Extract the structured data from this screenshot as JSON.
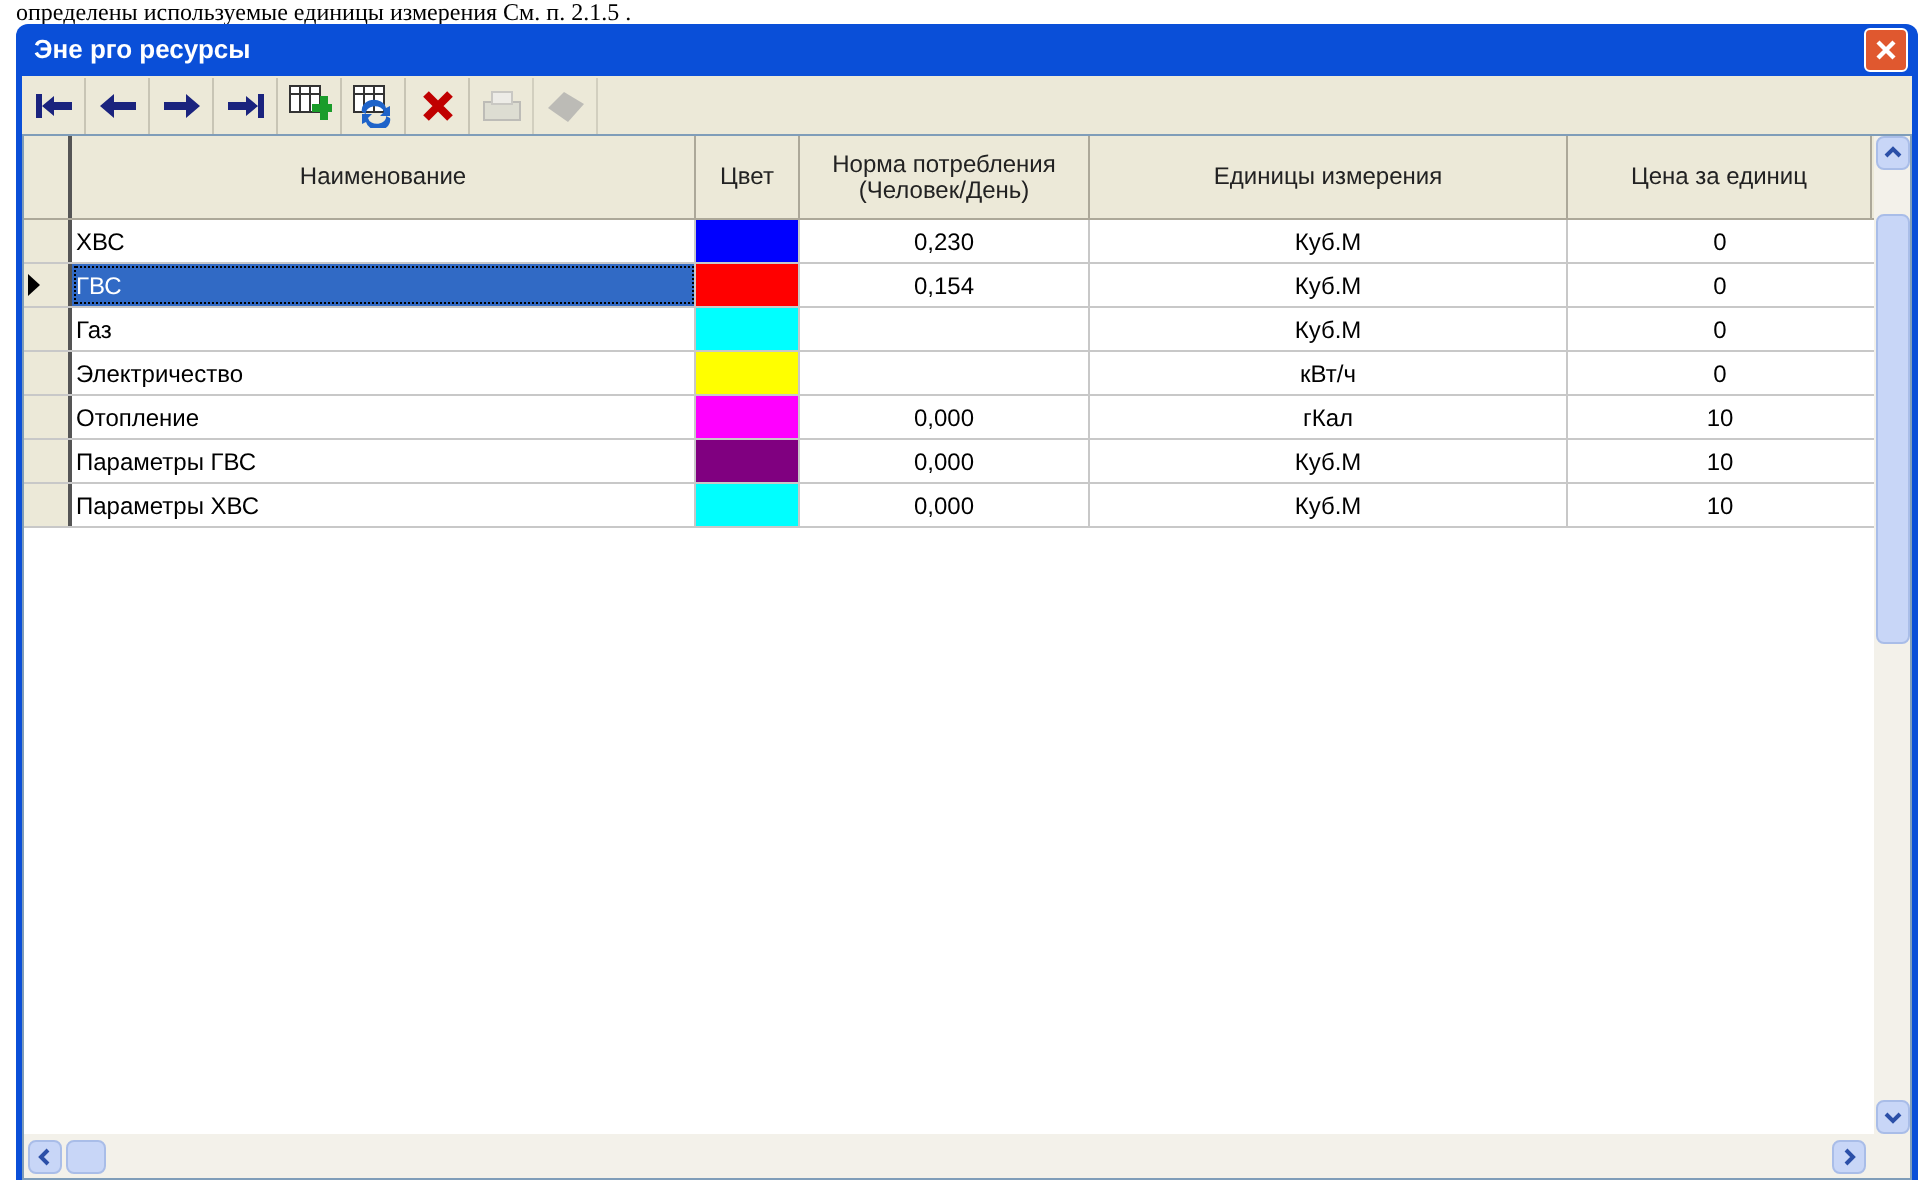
{
  "document_text": "определены используемые единицы измерения См. п. 2.1.5 .",
  "window": {
    "title": "Эне рго ресурсы"
  },
  "toolbar": [
    {
      "kind": "first",
      "disabled": false
    },
    {
      "kind": "prev",
      "disabled": false
    },
    {
      "kind": "next",
      "disabled": false
    },
    {
      "kind": "last",
      "disabled": false
    },
    {
      "kind": "add",
      "disabled": false
    },
    {
      "kind": "refresh",
      "disabled": false
    },
    {
      "kind": "delete",
      "disabled": false
    },
    {
      "kind": "print",
      "disabled": true
    },
    {
      "kind": "erase",
      "disabled": true
    }
  ],
  "table": {
    "columns": [
      "Наименование",
      "Цвет",
      "Норма потребления (Человек/День)",
      "Единицы измерения",
      "Цена за единиц"
    ],
    "rows": [
      {
        "name": "ХВС",
        "color": "#0000ff",
        "norm": "0,230",
        "unit": "Куб.М",
        "price": "0",
        "selected": false
      },
      {
        "name": "ГВС",
        "color": "#ff0000",
        "norm": "0,154",
        "unit": "Куб.М",
        "price": "0",
        "selected": true
      },
      {
        "name": "Газ",
        "color": "#00ffff",
        "unit": "Куб.М",
        "price": "0",
        "selected": false
      },
      {
        "name": "Электричество",
        "color": "#ffff00",
        "unit": "кВт/ч",
        "price": "0",
        "selected": false
      },
      {
        "name": "Отопление",
        "color": "#ff00ff",
        "norm": "0,000",
        "unit": "гКал",
        "price": "10",
        "selected": false
      },
      {
        "name": "Параметры ГВС",
        "color": "#800080",
        "norm": "0,000",
        "unit": "Куб.М",
        "price": "10",
        "selected": false
      },
      {
        "name": "Параметры ХВС",
        "color": "#00ffff",
        "norm": "0,000",
        "unit": "Куб.М",
        "price": "10",
        "selected": false
      }
    ]
  }
}
